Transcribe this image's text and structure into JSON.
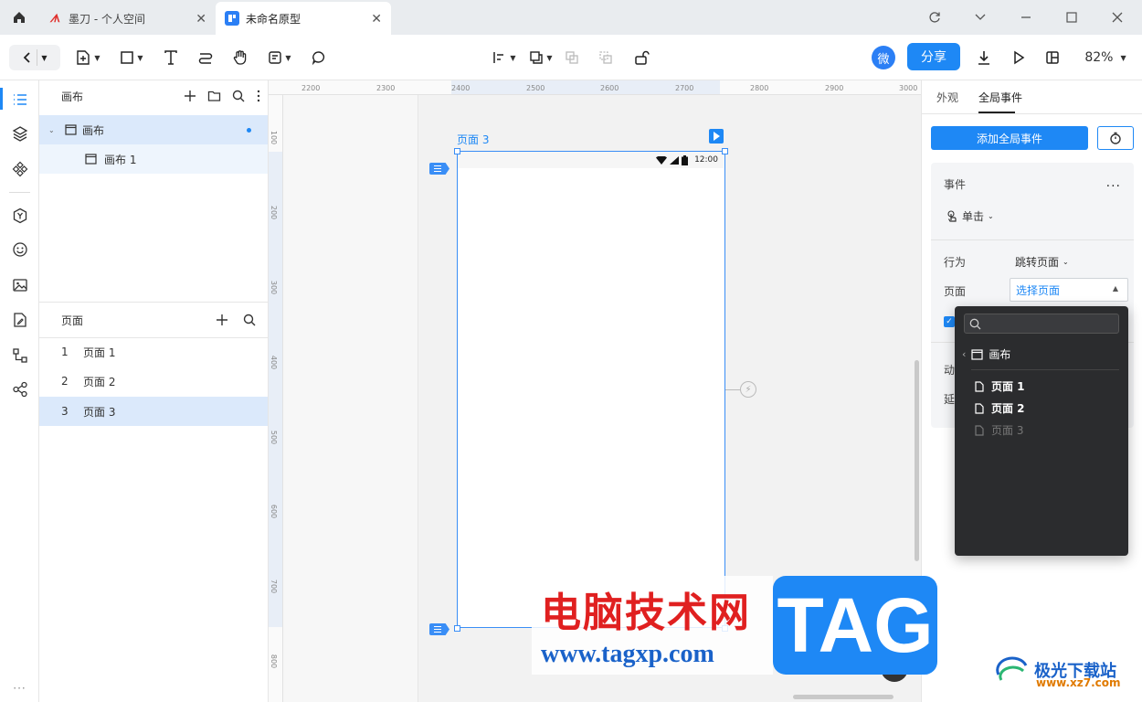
{
  "browser": {
    "tabs": [
      {
        "title": "墨刀 - 个人空间",
        "favicon": "mo-logo-icon",
        "active": false
      },
      {
        "title": "未命名原型",
        "favicon": "prototype-icon",
        "active": true
      }
    ]
  },
  "toolbar": {
    "avatar_label": "微",
    "share_label": "分享",
    "zoom": "82%"
  },
  "layers_panel": {
    "title": "画布",
    "tree": [
      {
        "label": "画布",
        "selected": true
      },
      {
        "label": "画布 1",
        "selected": false
      }
    ]
  },
  "pages_panel": {
    "title": "页面",
    "pages": [
      {
        "index": "1",
        "label": "页面 1",
        "selected": false
      },
      {
        "index": "2",
        "label": "页面 2",
        "selected": false
      },
      {
        "index": "3",
        "label": "页面 3",
        "selected": true
      }
    ]
  },
  "rulers": {
    "top": [
      "2200",
      "2300",
      "2400",
      "2500",
      "2600",
      "2700",
      "2800",
      "2900",
      "3000"
    ],
    "left": [
      "100",
      "200",
      "300",
      "400",
      "500",
      "600",
      "700",
      "800"
    ]
  },
  "canvas": {
    "frame_label": "页面 3",
    "status_time": "12:00"
  },
  "right_panel": {
    "tabs": [
      "外观",
      "全局事件"
    ],
    "active_tab": "全局事件",
    "add_event_label": "添加全局事件",
    "event_section_label": "事件",
    "trigger": "单击",
    "action_label": "行为",
    "action_value": "跳转页面",
    "page_label": "页面",
    "page_select_value": "选择页面",
    "truncated_row_1": "动",
    "truncated_row_2": "延"
  },
  "page_dropdown": {
    "group_label": "画布",
    "items": [
      {
        "label": "页面 1",
        "disabled": false
      },
      {
        "label": "页面 2",
        "disabled": false
      },
      {
        "label": "页面 3",
        "disabled": true
      }
    ]
  },
  "watermark": {
    "cn_text": "电脑技术网",
    "url": "www.tagxp.com",
    "tag": "TAG",
    "logo_name": "极光下载站",
    "logo_url": "www.xz7.com"
  },
  "colors": {
    "accent": "#1e88f5",
    "selection_bg": "#dbe9fb",
    "popover_bg": "#2b2c2e"
  }
}
